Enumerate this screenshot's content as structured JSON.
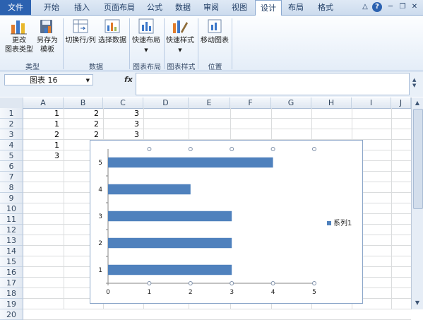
{
  "tabs": [
    "文件",
    "开始",
    "插入",
    "页面布局",
    "公式",
    "数据",
    "审阅",
    "视图",
    "设计",
    "布局",
    "格式"
  ],
  "active_tab_index": 8,
  "ribbon": {
    "change_type_line1": "更改",
    "change_type_line2": "图表类型",
    "save_as_template_line1": "另存为",
    "save_as_template_line2": "模板",
    "switch_row_col": "切换行/列",
    "select_data": "选择数据",
    "quick_layout": "快速布局",
    "quick_style": "快速样式",
    "move_chart": "移动图表",
    "group_type": "类型",
    "group_data": "数据",
    "group_chart_layouts": "图表布局",
    "group_chart_styles": "图表样式",
    "group_location": "位置"
  },
  "formula_bar": {
    "name_box": "图表 16",
    "fx_label": "fx",
    "formula": ""
  },
  "columns": [
    "A",
    "B",
    "C",
    "D",
    "E",
    "F",
    "G",
    "H",
    "I",
    "J"
  ],
  "rows": [
    "1",
    "2",
    "3",
    "4",
    "5",
    "6",
    "7",
    "8",
    "9",
    "10",
    "11",
    "12",
    "13",
    "14",
    "15",
    "16",
    "17",
    "18",
    "19",
    "20"
  ],
  "cells": [
    [
      "1",
      "2",
      "3"
    ],
    [
      "1",
      "2",
      "3"
    ],
    [
      "2",
      "2",
      "3"
    ],
    [
      "1",
      "",
      ""
    ],
    [
      "3",
      "",
      ""
    ]
  ],
  "chart_data": {
    "type": "bar",
    "orientation": "horizontal",
    "categories": [
      "1",
      "2",
      "3",
      "4",
      "5"
    ],
    "series": [
      {
        "name": "系列1",
        "values": [
          3,
          3,
          3,
          2,
          4
        ]
      }
    ],
    "xlim": [
      0,
      5
    ],
    "x_ticks": [
      "0",
      "1",
      "2",
      "3",
      "4",
      "5"
    ],
    "grid": false,
    "legend_position": "right",
    "bar_color": "#4f81bd"
  }
}
